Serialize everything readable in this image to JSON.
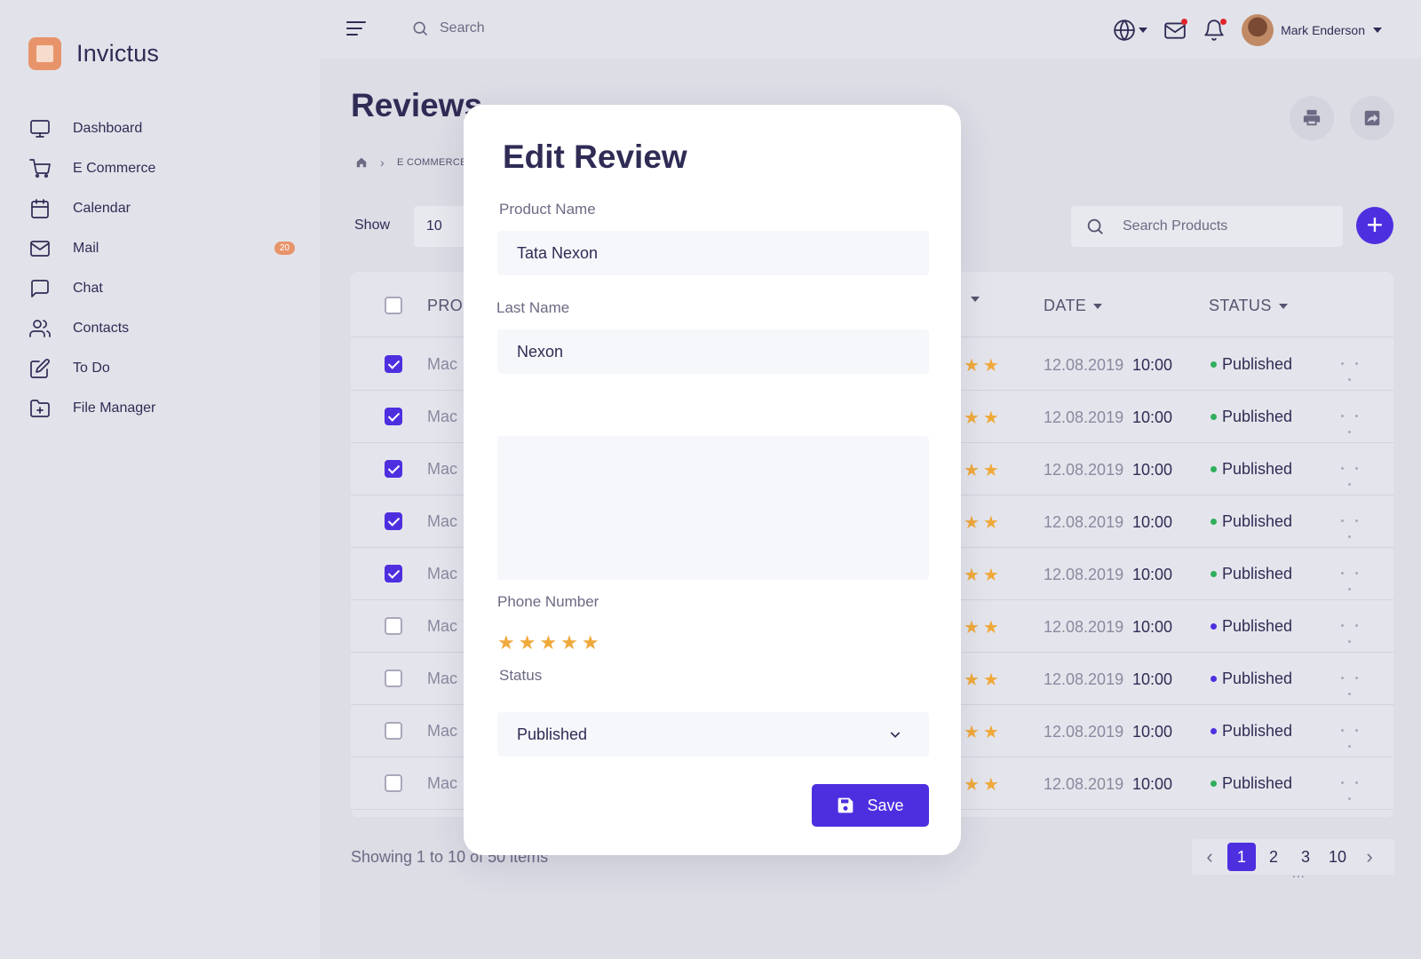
{
  "brand": {
    "name": "Invictus",
    "logo_color": "#e8946b"
  },
  "sidebar": {
    "items": [
      {
        "label": "Dashboard",
        "icon": "monitor-icon"
      },
      {
        "label": "E Commerce",
        "icon": "cart-icon"
      },
      {
        "label": "Calendar",
        "icon": "calendar-icon"
      },
      {
        "label": "Mail",
        "icon": "mail-icon",
        "badge": "20"
      },
      {
        "label": "Chat",
        "icon": "chat-icon"
      },
      {
        "label": "Contacts",
        "icon": "users-icon"
      },
      {
        "label": "To Do",
        "icon": "edit-icon"
      },
      {
        "label": "File Manager",
        "icon": "folder-plus-icon"
      }
    ]
  },
  "header": {
    "search_placeholder": "Search",
    "user_name": "Mark Enderson"
  },
  "page": {
    "title": "Reviews",
    "breadcrumb": "E COMMERCE",
    "show_label": "Show",
    "show_value": "10",
    "search_products_placeholder": "Search Products"
  },
  "table": {
    "headers": {
      "product": "PROD",
      "date": "DATE",
      "status": "STATUS"
    },
    "rows": [
      {
        "checked": true,
        "product": "Mac",
        "date": "12.08.2019",
        "time": "10:00",
        "status": "Published",
        "dot": "#2fae5b"
      },
      {
        "checked": true,
        "product": "Mac",
        "date": "12.08.2019",
        "time": "10:00",
        "status": "Published",
        "dot": "#2fae5b"
      },
      {
        "checked": true,
        "product": "Mac",
        "date": "12.08.2019",
        "time": "10:00",
        "status": "Published",
        "dot": "#2fae5b"
      },
      {
        "checked": true,
        "product": "Mac",
        "date": "12.08.2019",
        "time": "10:00",
        "status": "Published",
        "dot": "#2fae5b"
      },
      {
        "checked": true,
        "product": "Mac",
        "date": "12.08.2019",
        "time": "10:00",
        "status": "Published",
        "dot": "#2fae5b"
      },
      {
        "checked": false,
        "product": "Mac",
        "date": "12.08.2019",
        "time": "10:00",
        "status": "Published",
        "dot": "#4e2fe0"
      },
      {
        "checked": false,
        "product": "Mac",
        "date": "12.08.2019",
        "time": "10:00",
        "status": "Published",
        "dot": "#4e2fe0"
      },
      {
        "checked": false,
        "product": "Mac",
        "date": "12.08.2019",
        "time": "10:00",
        "status": "Published",
        "dot": "#4e2fe0"
      },
      {
        "checked": false,
        "product": "Mac",
        "date": "12.08.2019",
        "time": "10:00",
        "status": "Published",
        "dot": "#2fae5b"
      }
    ],
    "stars_visible": "★★"
  },
  "footer": {
    "showing": "Showing 1 to 10 of 50 items",
    "pages": [
      "1",
      "2",
      "3",
      "10"
    ],
    "active_page": "1",
    "ellipsis": "..."
  },
  "modal": {
    "title": "Edit Review",
    "product_name_label": "Product Name",
    "product_name_value": "Tata Nexon",
    "last_name_label": "Last Name",
    "last_name_value": "Nexon",
    "rating_label": "Phone Number",
    "rating": 5,
    "rating_max": 5,
    "stars": "★★★★★",
    "status_label": "Status",
    "status_value": "Published",
    "save_label": "Save"
  },
  "colors": {
    "accent": "#4e2fe0",
    "star": "#f0a93b",
    "badge": "#e8946b",
    "published_green": "#2fae5b"
  }
}
